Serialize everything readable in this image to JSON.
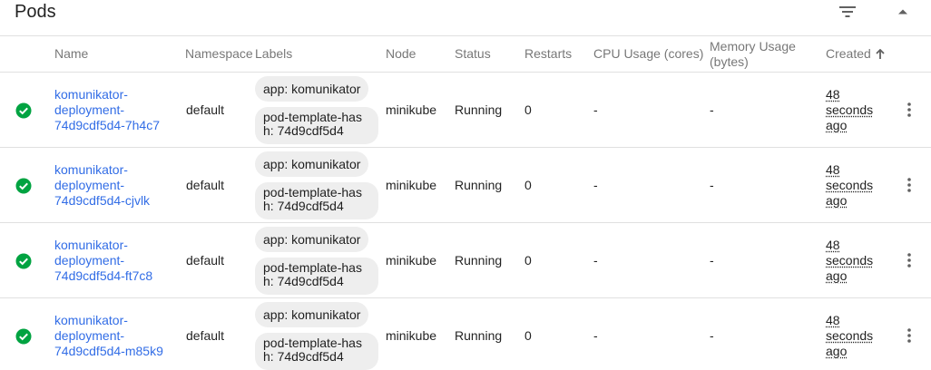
{
  "header": {
    "title": "Pods",
    "filter_icon": "filter-list-icon",
    "collapse_icon": "arrow-drop-up-icon"
  },
  "columns": {
    "name": "Name",
    "namespace": "Namespace",
    "labels": "Labels",
    "node": "Node",
    "status": "Status",
    "restarts": "Restarts",
    "cpu": "CPU Usage (cores)",
    "memory_line1": "Memory Usage",
    "memory_line2": "(bytes)",
    "created": "Created",
    "sort_icon": "arrow-upward-icon"
  },
  "colors": {
    "link": "#326de6",
    "status_ok": "#00a341",
    "chip_bg": "#eeeeee"
  },
  "pods": [
    {
      "name_line1": "komunikator-",
      "name_line2": "deployment-",
      "name_line3": "74d9cdf5d4-7h4c7",
      "namespace": "default",
      "label1": "app: komunikator",
      "label2_line1": "pod-template-has",
      "label2_line2": "h: 74d9cdf5d4",
      "node": "minikube",
      "status": "Running",
      "restarts": "0",
      "cpu": "-",
      "memory": "-",
      "created_line1": "48",
      "created_line2": "seconds",
      "created_line3": "ago"
    },
    {
      "name_line1": "komunikator-",
      "name_line2": "deployment-",
      "name_line3": "74d9cdf5d4-cjvlk",
      "namespace": "default",
      "label1": "app: komunikator",
      "label2_line1": "pod-template-has",
      "label2_line2": "h: 74d9cdf5d4",
      "node": "minikube",
      "status": "Running",
      "restarts": "0",
      "cpu": "-",
      "memory": "-",
      "created_line1": "48",
      "created_line2": "seconds",
      "created_line3": "ago"
    },
    {
      "name_line1": "komunikator-",
      "name_line2": "deployment-",
      "name_line3": "74d9cdf5d4-ft7c8",
      "namespace": "default",
      "label1": "app: komunikator",
      "label2_line1": "pod-template-has",
      "label2_line2": "h: 74d9cdf5d4",
      "node": "minikube",
      "status": "Running",
      "restarts": "0",
      "cpu": "-",
      "memory": "-",
      "created_line1": "48",
      "created_line2": "seconds",
      "created_line3": "ago"
    },
    {
      "name_line1": "komunikator-",
      "name_line2": "deployment-",
      "name_line3": "74d9cdf5d4-m85k9",
      "namespace": "default",
      "label1": "app: komunikator",
      "label2_line1": "pod-template-has",
      "label2_line2": "h: 74d9cdf5d4",
      "node": "minikube",
      "status": "Running",
      "restarts": "0",
      "cpu": "-",
      "memory": "-",
      "created_line1": "48",
      "created_line2": "seconds",
      "created_line3": "ago"
    }
  ]
}
